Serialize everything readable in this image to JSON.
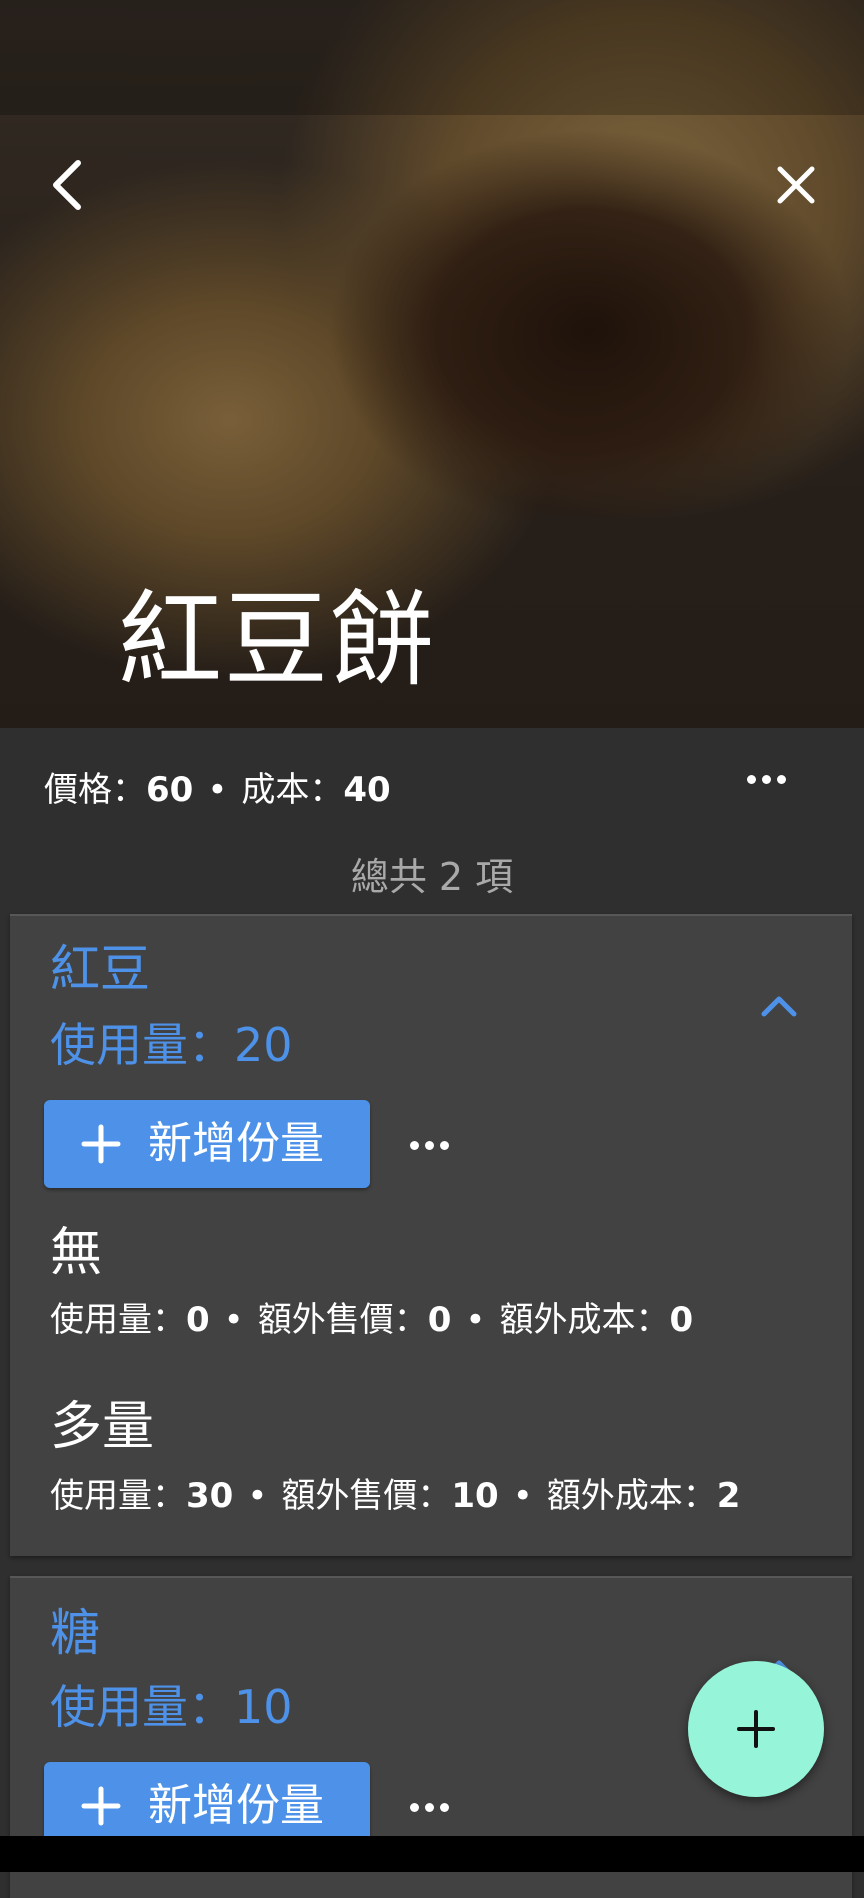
{
  "product": {
    "title": "紅豆餅",
    "price_label": "價格：",
    "price_value": "60",
    "cost_label": "成本：",
    "cost_value": "40",
    "separator": "•"
  },
  "summary": {
    "total_text": "總共 2 項"
  },
  "ingredients": [
    {
      "name": "紅豆",
      "usage": "使用量：20",
      "add_label": "新增份量",
      "portions": [
        {
          "name": "無",
          "usage_label": "使用量：",
          "usage_value": "0",
          "extra_price_label": "額外售價：",
          "extra_price_value": "0",
          "extra_cost_label": "額外成本：",
          "extra_cost_value": "0"
        },
        {
          "name": "多量",
          "usage_label": "使用量：",
          "usage_value": "30",
          "extra_price_label": "額外售價：",
          "extra_price_value": "10",
          "extra_cost_label": "額外成本：",
          "extra_cost_value": "2"
        }
      ]
    },
    {
      "name": "糖",
      "usage": "使用量：10",
      "add_label": "新增份量",
      "portions": []
    }
  ],
  "icons": {
    "back": "chevron-left-icon",
    "close": "close-icon",
    "more": "more-horizontal-icon",
    "collapse": "chevron-up-icon",
    "add": "plus-icon"
  },
  "colors": {
    "accent": "#4d92e8",
    "fab": "#96f4d8",
    "card": "#424242",
    "background": "#2f2f2f"
  }
}
